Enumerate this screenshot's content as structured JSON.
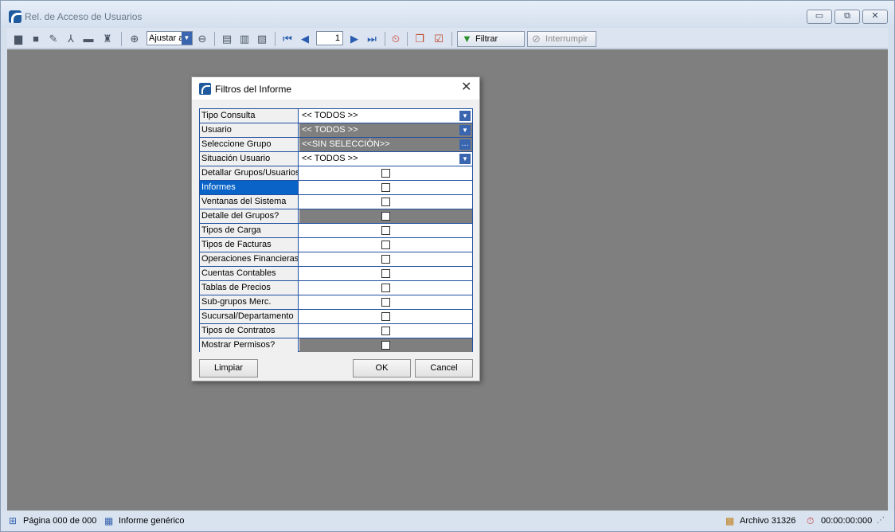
{
  "window": {
    "title": "Rel. de Acceso de Usuarios",
    "minimize_glyph": "▭",
    "restore_glyph": "⧉",
    "close_glyph": "✕"
  },
  "toolbar": {
    "zoom_value": "Ajustar a",
    "page_value": "1",
    "filter_label": "Filtrar",
    "interrupt_label": "Interrumpir"
  },
  "dialog": {
    "title": "Filtros del Informe",
    "rows": [
      {
        "label": "Tipo Consulta",
        "value": "<< TODOS >>"
      },
      {
        "label": "Usuario",
        "value": "<< TODOS >>"
      },
      {
        "label": "Seleccione Grupo",
        "value": "<<SIN SELECCIÓN>>"
      },
      {
        "label": "Situación Usuario",
        "value": "<< TODOS >>"
      },
      {
        "label": "Detallar Grupos/Usuarios"
      },
      {
        "label": "Informes"
      },
      {
        "label": "Ventanas del Sistema"
      },
      {
        "label": "Detalle del Grupos?"
      },
      {
        "label": "Tipos de Carga"
      },
      {
        "label": "Tipos de Facturas"
      },
      {
        "label": "Operaciones Financieras"
      },
      {
        "label": "Cuentas Contables"
      },
      {
        "label": "Tablas de Precios"
      },
      {
        "label": "Sub-grupos Merc."
      },
      {
        "label": "Sucursal/Departamento"
      },
      {
        "label": "Tipos de Contratos"
      },
      {
        "label": "Mostrar Permisos?"
      }
    ],
    "buttons": {
      "clear": "Limpiar",
      "ok": "OK",
      "cancel": "Cancel"
    }
  },
  "statusbar": {
    "page": "Página 000 de 000",
    "report": "Informe genérico",
    "file": "Archivo 31326",
    "time": "00:00:00:000"
  }
}
